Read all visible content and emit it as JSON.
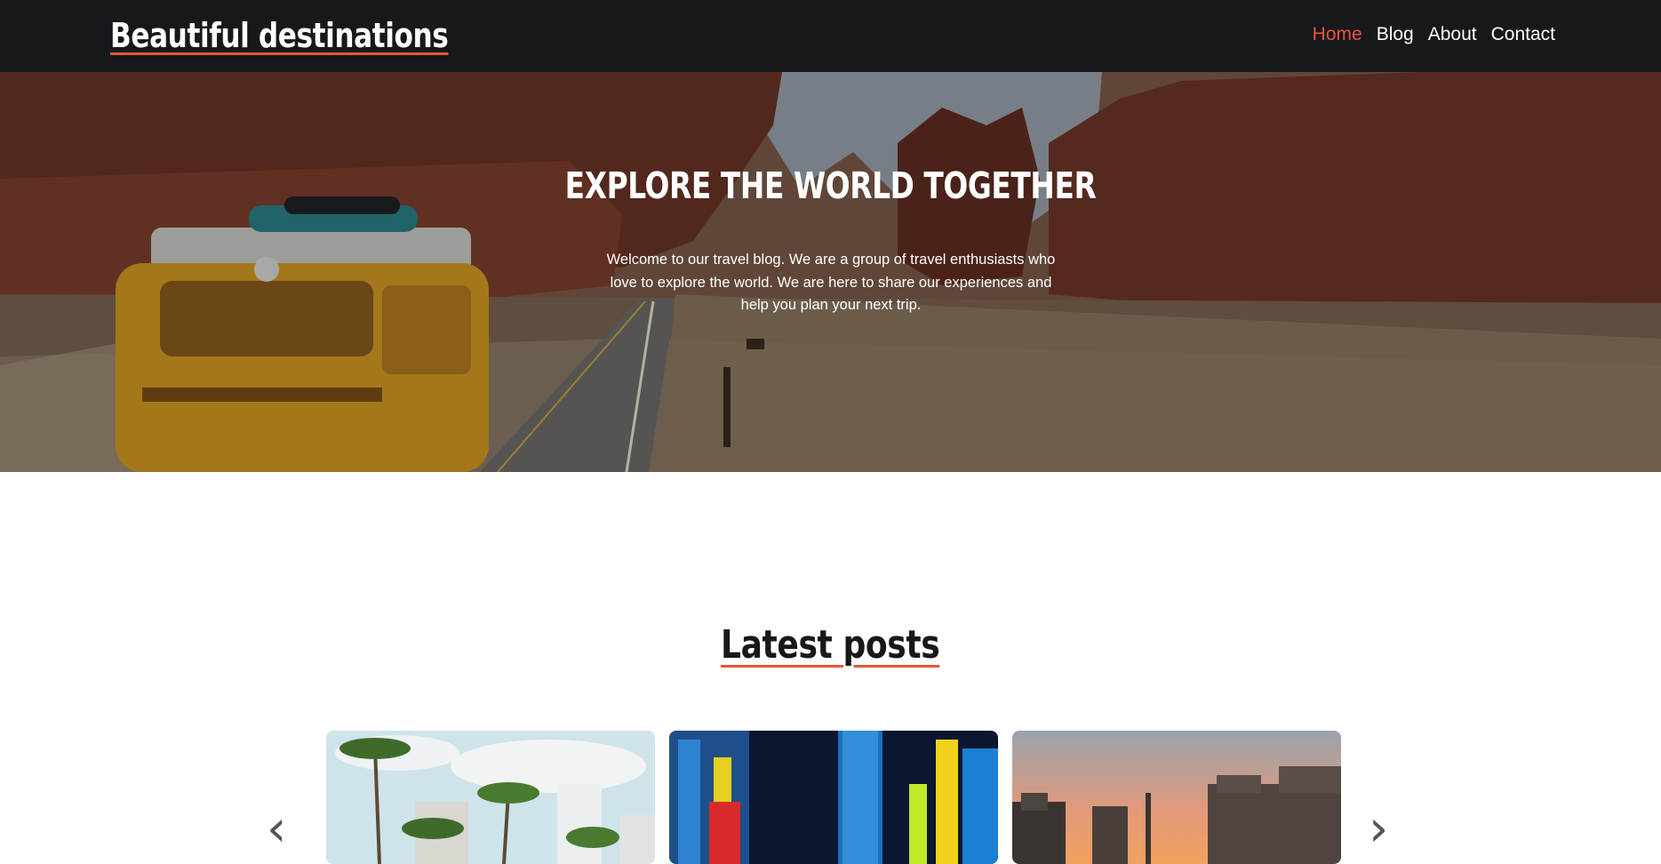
{
  "header": {
    "brand": "Beautiful destinations",
    "nav": [
      "Home",
      "Blog",
      "About",
      "Contact"
    ],
    "active_nav": "Home",
    "accent_color": "#e8553b",
    "background_color": "#17181c"
  },
  "hero": {
    "title": "EXPLORE THE WORLD TOGETHER",
    "text": "Welcome to our travel blog. We are a group of travel enthusiasts who love to explore the world. We are here to share our experiences and help you plan your next trip."
  },
  "latest": {
    "title": "Latest posts",
    "cards": [
      {
        "image": "palm-trees-city-photo"
      },
      {
        "image": "neon-street-night-photo"
      },
      {
        "image": "canal-houses-sunset-photo"
      }
    ],
    "prev_icon": "‹",
    "next_icon": "›"
  }
}
